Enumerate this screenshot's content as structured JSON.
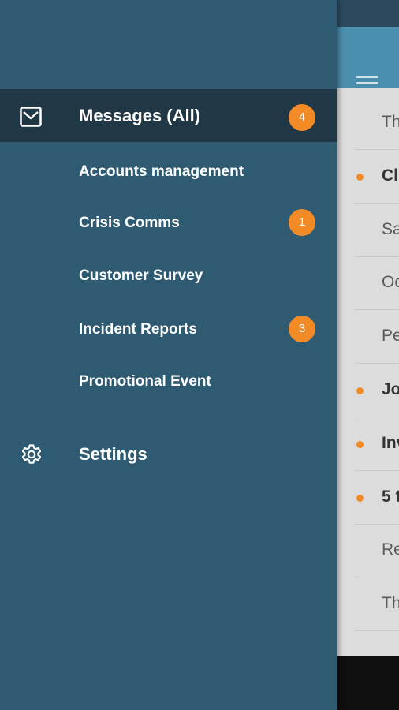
{
  "drawer": {
    "messages_all": {
      "label": "Messages (All)",
      "badge": "4",
      "icon": "envelope-icon"
    },
    "folders": [
      {
        "label": "Accounts management",
        "badge": ""
      },
      {
        "label": "Crisis Comms",
        "badge": "1"
      },
      {
        "label": "Customer Survey",
        "badge": ""
      },
      {
        "label": "Incident Reports",
        "badge": "3"
      },
      {
        "label": "Promotional Event",
        "badge": ""
      }
    ],
    "settings": {
      "label": "Settings",
      "icon": "gear-icon"
    }
  },
  "background_list": {
    "rows": [
      {
        "text": "Th",
        "unread": false
      },
      {
        "text": "Cl",
        "unread": true
      },
      {
        "text": "Sa",
        "unread": false
      },
      {
        "text": "Oc",
        "unread": false
      },
      {
        "text": "Pe",
        "unread": false
      },
      {
        "text": "Jo",
        "unread": true
      },
      {
        "text": "Inv",
        "unread": true
      },
      {
        "text": "5 t",
        "unread": true
      },
      {
        "text": "Re",
        "unread": false
      },
      {
        "text": "Th",
        "unread": false
      }
    ]
  },
  "colors": {
    "accent": "#f28a26",
    "drawer": "#2f5b72",
    "selected": "#203746",
    "toolbar": "#4b8fae"
  }
}
